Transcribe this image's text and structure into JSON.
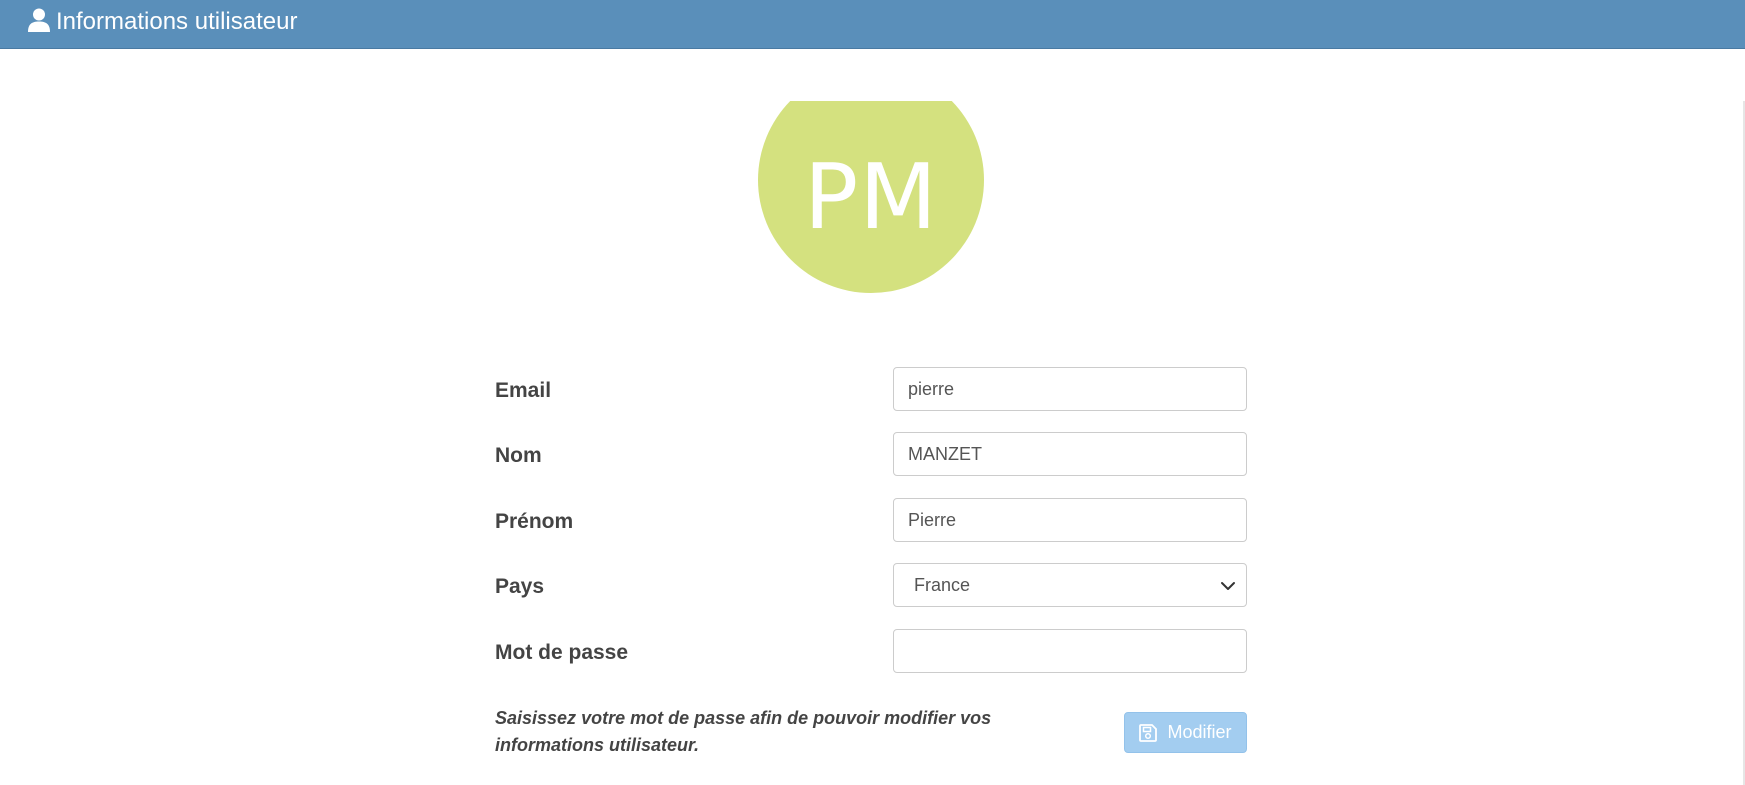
{
  "header": {
    "title": "Informations utilisateur",
    "icon": "user-icon",
    "background": "#5a8fba"
  },
  "avatar": {
    "initials": "PM",
    "color": "#d4e17f"
  },
  "form": {
    "email": {
      "label": "Email",
      "value": "pierre"
    },
    "nom": {
      "label": "Nom",
      "value": "MANZET"
    },
    "prenom": {
      "label": "Prénom",
      "value": "Pierre"
    },
    "pays": {
      "label": "Pays",
      "selected": "France",
      "icon": "chevron-down-icon"
    },
    "mot_de_passe": {
      "label": "Mot de passe",
      "value": ""
    },
    "help_text": "Saisissez votre mot de passe afin de pouvoir modifier vos informations utilisateur.",
    "submit": {
      "label": "Modifier",
      "icon": "save-icon",
      "color": "#a3cdf0"
    }
  }
}
